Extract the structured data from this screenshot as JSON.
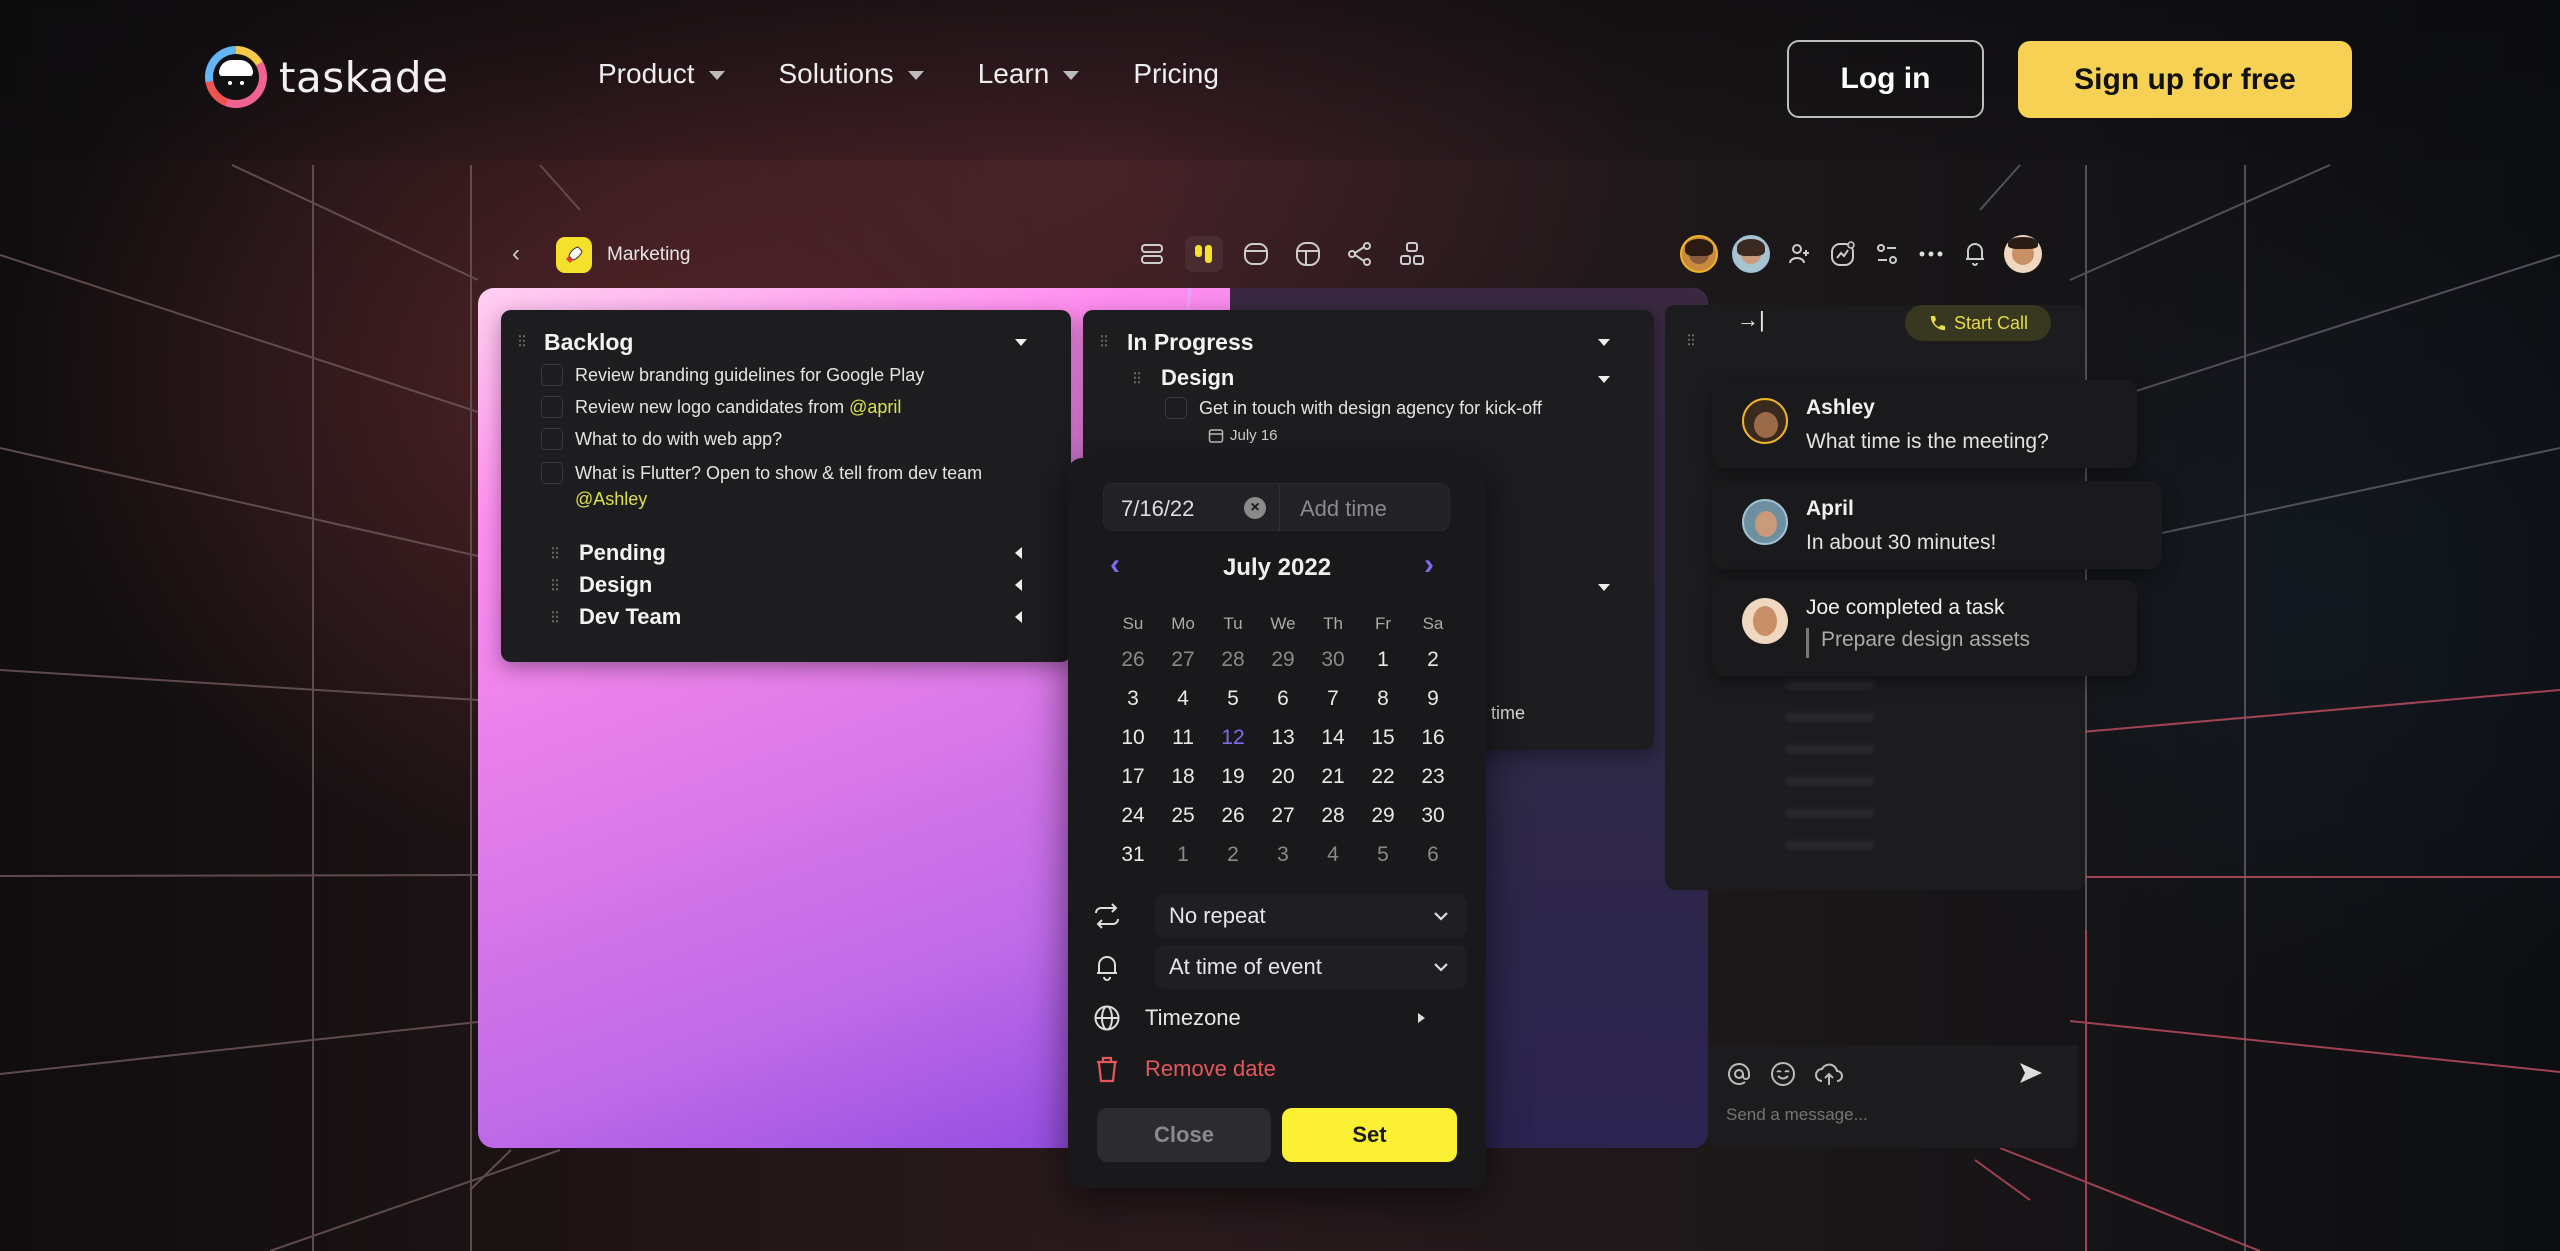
{
  "brand": {
    "name": "taskade"
  },
  "nav": {
    "links": [
      {
        "label": "Product",
        "has_dropdown": true
      },
      {
        "label": "Solutions",
        "has_dropdown": true
      },
      {
        "label": "Learn",
        "has_dropdown": true
      },
      {
        "label": "Pricing",
        "has_dropdown": false
      }
    ],
    "login_label": "Log in",
    "signup_label": "Sign up for free"
  },
  "app": {
    "project_name": "Marketing",
    "project_icon": "rocket-icon",
    "view_icons": [
      "list-view-icon",
      "board-view-icon",
      "calendar-view-icon",
      "table-view-icon",
      "mindmap-view-icon",
      "org-chart-view-icon"
    ],
    "active_view": "board-view-icon",
    "toolbar_icons": [
      "add-member-icon",
      "activity-icon",
      "filter-icon",
      "more-icon",
      "bell-icon"
    ],
    "collaborators": [
      "Ashley",
      "April",
      "Joe"
    ]
  },
  "board": {
    "columns": [
      {
        "title": "Backlog",
        "tasks": [
          {
            "text": "Review branding guidelines for Google Play",
            "mention": ""
          },
          {
            "text": "Review new logo candidates from ",
            "mention": "@april"
          },
          {
            "text": "What to do with web app?",
            "mention": ""
          },
          {
            "text": "What is Flutter? Open to show & tell from dev team",
            "mention": "@Ashley"
          }
        ],
        "subgroups": [
          "Pending",
          "Design",
          "Dev Team"
        ]
      },
      {
        "title": "In Progress",
        "subgroup": "Design",
        "tasks": [
          {
            "text": "Get in touch with design agency for kick-off",
            "due": "July 16"
          }
        ],
        "partial_text": "re time"
      }
    ]
  },
  "date_picker": {
    "date_value": "7/16/22",
    "time_placeholder": "Add time",
    "month_label": "July 2022",
    "weekdays": [
      "Su",
      "Mo",
      "Tu",
      "We",
      "Th",
      "Fr",
      "Sa"
    ],
    "days": [
      [
        "26",
        "27",
        "28",
        "29",
        "30",
        "1",
        "2"
      ],
      [
        "3",
        "4",
        "5",
        "6",
        "7",
        "8",
        "9"
      ],
      [
        "10",
        "11",
        "12",
        "13",
        "14",
        "15",
        "16"
      ],
      [
        "17",
        "18",
        "19",
        "20",
        "21",
        "22",
        "23"
      ],
      [
        "24",
        "25",
        "26",
        "27",
        "28",
        "29",
        "30"
      ],
      [
        "31",
        "1",
        "2",
        "3",
        "4",
        "5",
        "6"
      ]
    ],
    "today": "12",
    "repeat_value": "No repeat",
    "reminder_value": "At time of event",
    "timezone_label": "Timezone",
    "remove_label": "Remove date",
    "close_label": "Close",
    "set_label": "Set"
  },
  "chat": {
    "start_call_label": "Start Call",
    "messages": [
      {
        "author": "Ashley",
        "text": "What time is the meeting?"
      },
      {
        "author": "April",
        "text": "In about 30 minutes!"
      },
      {
        "author": "Joe completed a task",
        "quote": "Prepare design assets"
      }
    ],
    "input_placeholder": "Send a message..."
  },
  "colors": {
    "accent_yellow": "#f7d154",
    "set_yellow": "#fbf033",
    "calendar_accent": "#7b6cf0",
    "danger": "#e5585a",
    "mention": "#d9e24a"
  }
}
